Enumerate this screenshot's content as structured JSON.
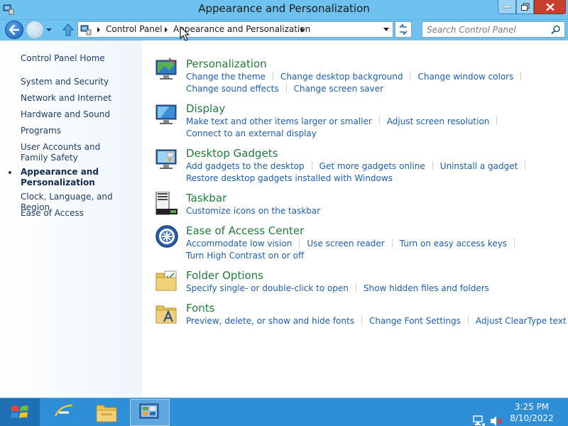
{
  "window": {
    "title": "Appearance and Personalization"
  },
  "navbar": {
    "breadcrumb": [
      "Control Panel",
      "Appearance and Personalization"
    ],
    "search_placeholder": "Search Control Panel"
  },
  "sidebar": {
    "items": [
      {
        "label": "Control Panel Home"
      },
      {
        "label": "System and Security"
      },
      {
        "label": "Network and Internet"
      },
      {
        "label": "Hardware and Sound"
      },
      {
        "label": "Programs"
      },
      {
        "label": "User Accounts and Family Safety"
      },
      {
        "label": "Appearance and Personalization",
        "current": true
      },
      {
        "label": "Clock, Language, and Region"
      },
      {
        "label": "Ease of Access"
      }
    ]
  },
  "categories": [
    {
      "title": "Personalization",
      "icon": "personalization-icon",
      "links": [
        "Change the theme",
        "Change desktop background",
        "Change window colors",
        "Change sound effects",
        "Change screen saver"
      ]
    },
    {
      "title": "Display",
      "icon": "display-icon",
      "links": [
        "Make text and other items larger or smaller",
        "Adjust screen resolution",
        "Connect to an external display"
      ]
    },
    {
      "title": "Desktop Gadgets",
      "icon": "gadgets-icon",
      "links": [
        "Add gadgets to the desktop",
        "Get more gadgets online",
        "Uninstall a gadget",
        "Restore desktop gadgets installed with Windows"
      ]
    },
    {
      "title": "Taskbar",
      "icon": "taskbar-icon",
      "links": [
        "Customize icons on the taskbar"
      ]
    },
    {
      "title": "Ease of Access Center",
      "icon": "ease-of-access-icon",
      "links": [
        "Accommodate low vision",
        "Use screen reader",
        "Turn on easy access keys",
        "Turn High Contrast on or off"
      ]
    },
    {
      "title": "Folder Options",
      "icon": "folder-options-icon",
      "links": [
        "Specify single- or double-click to open",
        "Show hidden files and folders"
      ]
    },
    {
      "title": "Fonts",
      "icon": "fonts-icon",
      "links": [
        "Preview, delete, or show and hide fonts",
        "Change Font Settings",
        "Adjust ClearType text"
      ]
    }
  ],
  "taskbar": {
    "apps": [
      {
        "name": "internet-explorer-icon"
      },
      {
        "name": "file-explorer-icon"
      },
      {
        "name": "control-panel-icon",
        "active": true
      }
    ],
    "clock": {
      "time": "3:25 PM",
      "date": "8/10/2022"
    }
  },
  "colors": {
    "title_bar": "#6dc2ef",
    "category_title": "#1e7d3a",
    "link": "#1a5fb4",
    "taskbar": "#2f8fd6"
  }
}
